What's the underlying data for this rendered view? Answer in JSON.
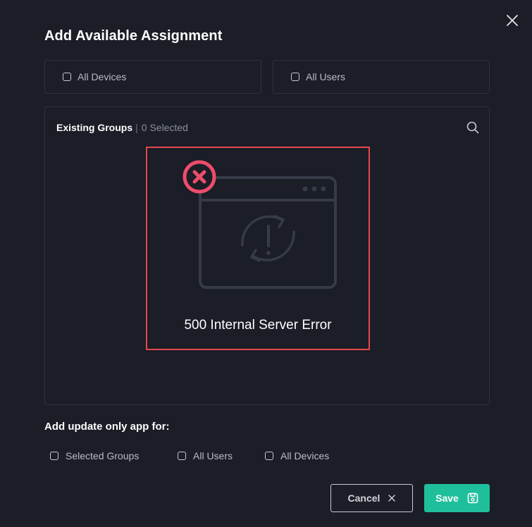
{
  "dialog": {
    "title": "Add Available Assignment",
    "close_icon": "close-icon"
  },
  "assign_options": [
    {
      "label": "All Devices",
      "checked": false
    },
    {
      "label": "All Users",
      "checked": false
    }
  ],
  "groups": {
    "title": "Existing Groups",
    "separator": "|",
    "selected_text": "0 Selected",
    "search_icon": "search-icon",
    "error": {
      "icon": "error-x-icon",
      "illustration": "browser-refresh-alert-icon",
      "message": "500 Internal Server Error",
      "color": "#e5484d"
    }
  },
  "update_only": {
    "label": "Add update only app for:",
    "options": [
      {
        "label": "Selected Groups",
        "checked": false
      },
      {
        "label": "All Users",
        "checked": false
      },
      {
        "label": "All Devices",
        "checked": false
      }
    ]
  },
  "actions": {
    "cancel_label": "Cancel",
    "save_label": "Save",
    "save_color": "#1fbf9c"
  }
}
